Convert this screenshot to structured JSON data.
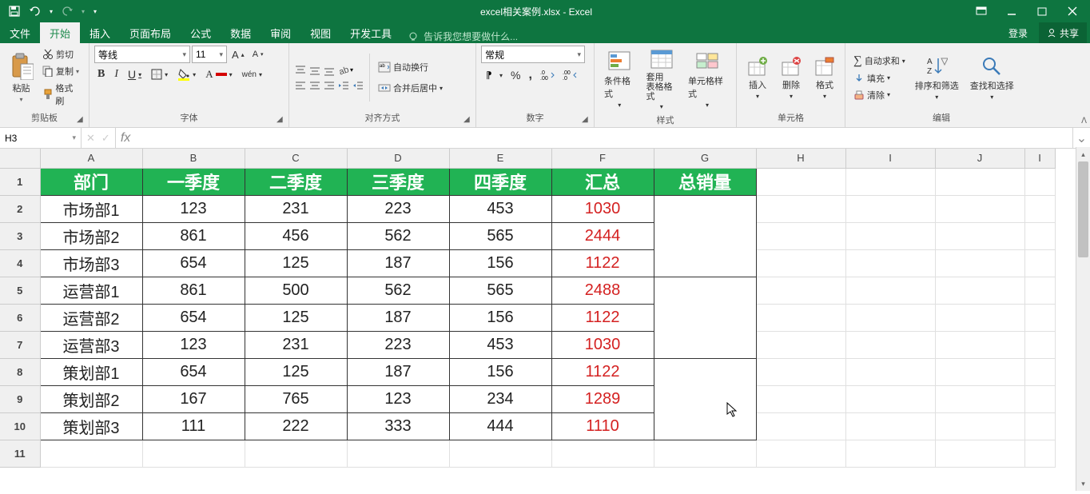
{
  "title": "excel相关案例.xlsx - Excel",
  "qat": {
    "save": "保存",
    "undo": "撤销",
    "redo": "重做"
  },
  "window": {
    "login": "登录",
    "share": "共享"
  },
  "tabs": {
    "file": "文件",
    "home": "开始",
    "insert": "插入",
    "pagelayout": "页面布局",
    "formulas": "公式",
    "data": "数据",
    "review": "审阅",
    "view": "视图",
    "dev": "开发工具",
    "tellme": "告诉我您想要做什么..."
  },
  "ribbon": {
    "clipboard": {
      "label": "剪贴板",
      "paste": "粘贴",
      "cut": "剪切",
      "copy": "复制",
      "format_painter": "格式刷"
    },
    "font": {
      "label": "字体",
      "name": "等线",
      "size": "11",
      "bold": "B",
      "italic": "I",
      "underline": "U",
      "pinyin": "wén"
    },
    "alignment": {
      "label": "对齐方式",
      "wrap": "自动换行",
      "merge": "合并后居中"
    },
    "number": {
      "label": "数字",
      "format": "常规"
    },
    "styles": {
      "label": "样式",
      "cond": "条件格式",
      "table": "套用\n表格格式",
      "cell": "单元格样式"
    },
    "cells": {
      "label": "单元格",
      "insert": "插入",
      "delete": "删除",
      "format": "格式"
    },
    "editing": {
      "label": "编辑",
      "autosum": "自动求和",
      "fill": "填充",
      "clear": "清除",
      "sort": "排序和筛选",
      "find": "查找和选择"
    }
  },
  "namebox": "H3",
  "columns": [
    "A",
    "B",
    "C",
    "D",
    "E",
    "F",
    "G",
    "H",
    "I",
    "J",
    "I"
  ],
  "rows": [
    "1",
    "2",
    "3",
    "4",
    "5",
    "6",
    "7",
    "8",
    "9",
    "10",
    "11"
  ],
  "headers": {
    "dept": "部门",
    "q1": "一季度",
    "q2": "二季度",
    "q3": "三季度",
    "q4": "四季度",
    "sum": "汇总",
    "total": "总销量"
  },
  "data": [
    {
      "dept": "市场部1",
      "q1": "123",
      "q2": "231",
      "q3": "223",
      "q4": "453",
      "sum": "1030"
    },
    {
      "dept": "市场部2",
      "q1": "861",
      "q2": "456",
      "q3": "562",
      "q4": "565",
      "sum": "2444"
    },
    {
      "dept": "市场部3",
      "q1": "654",
      "q2": "125",
      "q3": "187",
      "q4": "156",
      "sum": "1122"
    },
    {
      "dept": "运营部1",
      "q1": "861",
      "q2": "500",
      "q3": "562",
      "q4": "565",
      "sum": "2488"
    },
    {
      "dept": "运营部2",
      "q1": "654",
      "q2": "125",
      "q3": "187",
      "q4": "156",
      "sum": "1122"
    },
    {
      "dept": "运营部3",
      "q1": "123",
      "q2": "231",
      "q3": "223",
      "q4": "453",
      "sum": "1030"
    },
    {
      "dept": "策划部1",
      "q1": "654",
      "q2": "125",
      "q3": "187",
      "q4": "156",
      "sum": "1122"
    },
    {
      "dept": "策划部2",
      "q1": "167",
      "q2": "765",
      "q3": "123",
      "q4": "234",
      "sum": "1289"
    },
    {
      "dept": "策划部3",
      "q1": "111",
      "q2": "222",
      "q3": "333",
      "q4": "444",
      "sum": "1110"
    }
  ]
}
